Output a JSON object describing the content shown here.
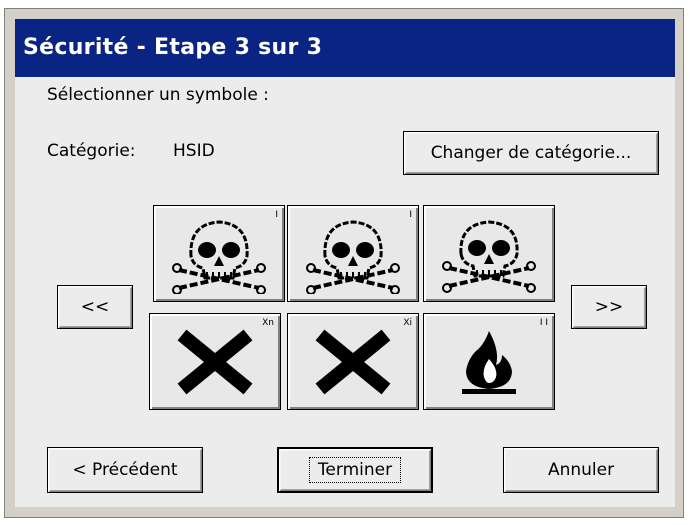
{
  "window": {
    "title": "Sécurité - Etape 3 sur 3"
  },
  "dialog": {
    "prompt": "Sélectionner un symbole :",
    "category_label": "Catégorie:",
    "category_value": "HSID",
    "change_category_button": "Changer de catégorie..."
  },
  "navigation": {
    "prev_page": "<<",
    "next_page": ">>"
  },
  "symbols": [
    {
      "icon": "skull-crossbones-icon",
      "corner_mark": "I"
    },
    {
      "icon": "skull-crossbones-icon",
      "corner_mark": "I"
    },
    {
      "icon": "skull-crossbones-icon",
      "corner_mark": ""
    },
    {
      "icon": "harmful-x-icon",
      "corner_mark": "Xn"
    },
    {
      "icon": "irritant-x-icon",
      "corner_mark": "Xi"
    },
    {
      "icon": "flame-icon",
      "corner_mark": "I I"
    }
  ],
  "footer": {
    "previous_button": "< Précédent",
    "finish_button": "Terminer",
    "cancel_button": "Annuler"
  },
  "colors": {
    "titlebar": "#0a2483",
    "dialog_background": "#ececec"
  }
}
